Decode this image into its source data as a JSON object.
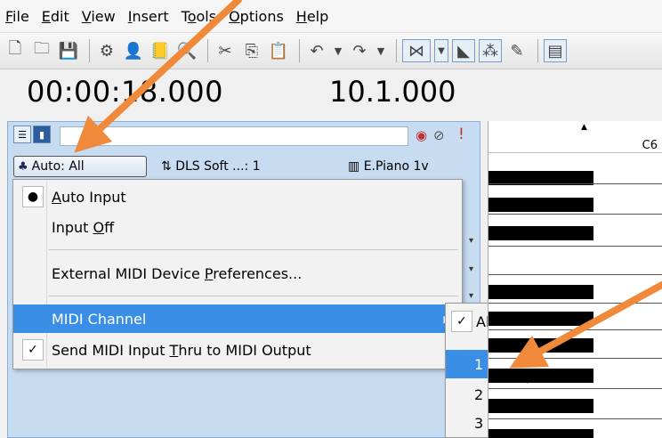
{
  "menubar": {
    "items": [
      {
        "pre": "",
        "ul": "F",
        "post": "ile"
      },
      {
        "pre": "",
        "ul": "E",
        "post": "dit"
      },
      {
        "pre": "",
        "ul": "V",
        "post": "iew"
      },
      {
        "pre": "",
        "ul": "I",
        "post": "nsert"
      },
      {
        "pre": "T",
        "ul": "o",
        "post": "ols"
      },
      {
        "pre": "",
        "ul": "O",
        "post": "ptions"
      },
      {
        "pre": "",
        "ul": "H",
        "post": "elp"
      }
    ]
  },
  "toolbar": {
    "icons": [
      "new-file-icon",
      "open-folder-icon",
      "save-icon",
      "metronome-icon",
      "user-icon",
      "notepad-icon",
      "magnifier-icon",
      "cut-icon",
      "copy-icon",
      "paste-icon",
      "undo-icon",
      "undo-dropdown-icon",
      "redo-icon",
      "redo-dropdown-icon",
      "snap-icon",
      "snap-dropdown-icon",
      "velocity-icon",
      "pattern-icon",
      "brush-icon",
      "view-icon"
    ]
  },
  "transport": {
    "time": "00:00:18.000",
    "measure": "10.1.000"
  },
  "track": {
    "input_button": "Auto: All",
    "output": "DLS Soft ...: 1",
    "instrument": "E.Piano 1v"
  },
  "context_menu": {
    "auto_input": {
      "ul": "A",
      "post": "uto Input"
    },
    "input_off": {
      "pre": "Input ",
      "ul": "O",
      "post": "ff"
    },
    "ext_midi": {
      "pre": "External MIDI Device ",
      "ul": "P",
      "post": "references..."
    },
    "midi_channel": "MIDI Channel",
    "send_thru": {
      "pre": "Send MIDI Input ",
      "ul": "T",
      "post": "hru to MIDI Output"
    }
  },
  "submenu": {
    "items": [
      "All",
      "1",
      "2",
      "3"
    ],
    "checked": "All",
    "highlighted": "1"
  },
  "pianoroll": {
    "note_label": "C6"
  },
  "colors": {
    "highlight": "#3a8ee6",
    "track_panel": "#c7dbf1",
    "annotation_arrow": "#f08a3a"
  }
}
